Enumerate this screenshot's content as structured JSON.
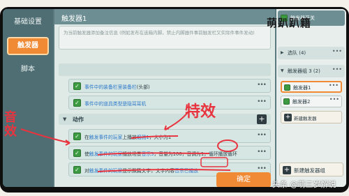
{
  "left_nav": {
    "items": [
      {
        "label": "基础设置"
      },
      {
        "label": "触发器",
        "active": true
      },
      {
        "label": "脚本"
      }
    ]
  },
  "main": {
    "trigger_title": "触发器1",
    "note_placeholder": "为当前触发器添加备注信息 (例如发布在选箱内脚，禁止内脚器件事前触发栏又实际件事件发动)",
    "condition_rows": [
      {
        "text_a": "事件中的装备栏里装备栏",
        "text_b": "(头部)"
      },
      {
        "text_a": "事件中的道具类型是隐耳耳机",
        "text_b": ""
      }
    ],
    "action_section_label": "动作",
    "action_rows": [
      {
        "pre": "在",
        "h1": "触发事件的玩家",
        "mid": "上播放",
        "h2": "烟溅1",
        "post": "，大小为1"
      },
      {
        "pre": "使",
        "h1": "触发事件的玩家",
        "mid": "播放场景",
        "h2": "音乐3",
        "post": "，音量为100，音调为1，循环播放循环"
      },
      {
        "pre": "对",
        "h1": "触发事件的玩家",
        "mid": "显示飘篇文字，文字内容",
        "h2": "音乐已播放",
        "post": ""
      }
    ],
    "confirm_label": "确定"
  },
  "right_panel": {
    "toggle_label": "触发器开关",
    "group1_label": "选队 (4)",
    "group2_label": "触发器组 3 (2)",
    "items": [
      {
        "label": "触发器1",
        "selected": true
      },
      {
        "label": "触发器2",
        "selected": false
      }
    ],
    "new_trigger_label": "新建触发器",
    "new_group_label": "新建触发器组"
  },
  "overlays": {
    "logo_text": "萌趴趴籍",
    "handwriting_top": "特效",
    "handwriting_left": "音效",
    "watermark": "头条 @萌三岁解说"
  },
  "colors": {
    "accent": "#f08a35",
    "annotation": "#e8343f",
    "checkbox": "#3c9a40",
    "link": "#2e77c9"
  }
}
